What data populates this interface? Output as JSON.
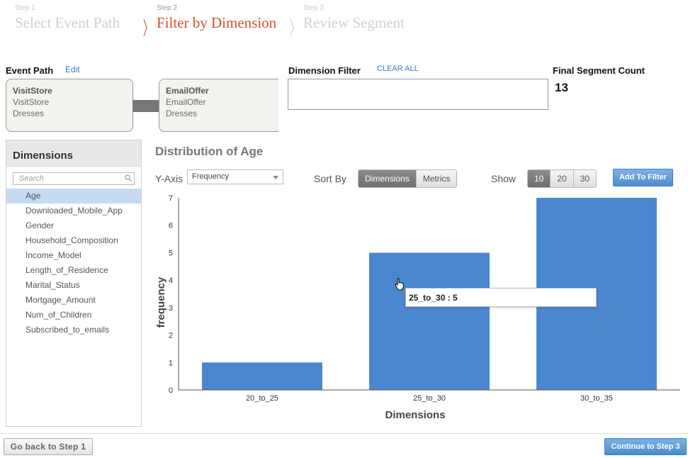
{
  "steps": [
    {
      "num": "Step 1",
      "title": "Select Event Path"
    },
    {
      "num": "Step 2",
      "title": "Filter by Dimension"
    },
    {
      "num": "Step 3",
      "title": "Review Segment"
    }
  ],
  "event_path": {
    "label": "Event Path",
    "edit": "Edit",
    "cards": [
      {
        "line1": "VisitStore",
        "line2": "VisitStore",
        "line3": "Dresses"
      },
      {
        "line1": "EmailOffer",
        "line2": "EmailOffer",
        "line3": "Dresses"
      }
    ]
  },
  "dimension_filter": {
    "label": "Dimension Filter",
    "clear": "CLEAR ALL"
  },
  "final_count": {
    "label": "Final Segment Count",
    "value": "13"
  },
  "sidebar": {
    "title": "Dimensions",
    "search_placeholder": "Search",
    "items": [
      "Age",
      "Downloaded_Mobile_App",
      "Gender",
      "Household_Composition",
      "Income_Model",
      "Length_of_Residence",
      "Marital_Status",
      "Mortgage_Amount",
      "Num_of_Children",
      "Subscribed_to_emails"
    ],
    "selected": "Age"
  },
  "chart_panel": {
    "title": "Distribution of Age",
    "yaxis_label": "Y-Axis",
    "yaxis_value": "Frequency",
    "sortby_label": "Sort By",
    "sort_options": [
      "Dimensions",
      "Metrics"
    ],
    "sort_selected": "Dimensions",
    "show_label": "Show",
    "show_options": [
      "10",
      "20",
      "30"
    ],
    "show_selected": "10",
    "add_filter": "Add To Filter",
    "tooltip": "25_to_30 : 5"
  },
  "chart_data": {
    "type": "bar",
    "categories": [
      "20_to_25",
      "25_to_30",
      "30_to_35"
    ],
    "values": [
      1,
      5,
      7
    ],
    "xlabel": "Dimensions",
    "ylabel": "frequency",
    "ylim": [
      0,
      7
    ],
    "yticks": [
      0,
      1,
      2,
      3,
      4,
      5,
      6,
      7
    ],
    "bar_color": "#4a87cf"
  },
  "footer": {
    "back": "Go back to Step 1",
    "continue": "Continue to Step 3"
  }
}
